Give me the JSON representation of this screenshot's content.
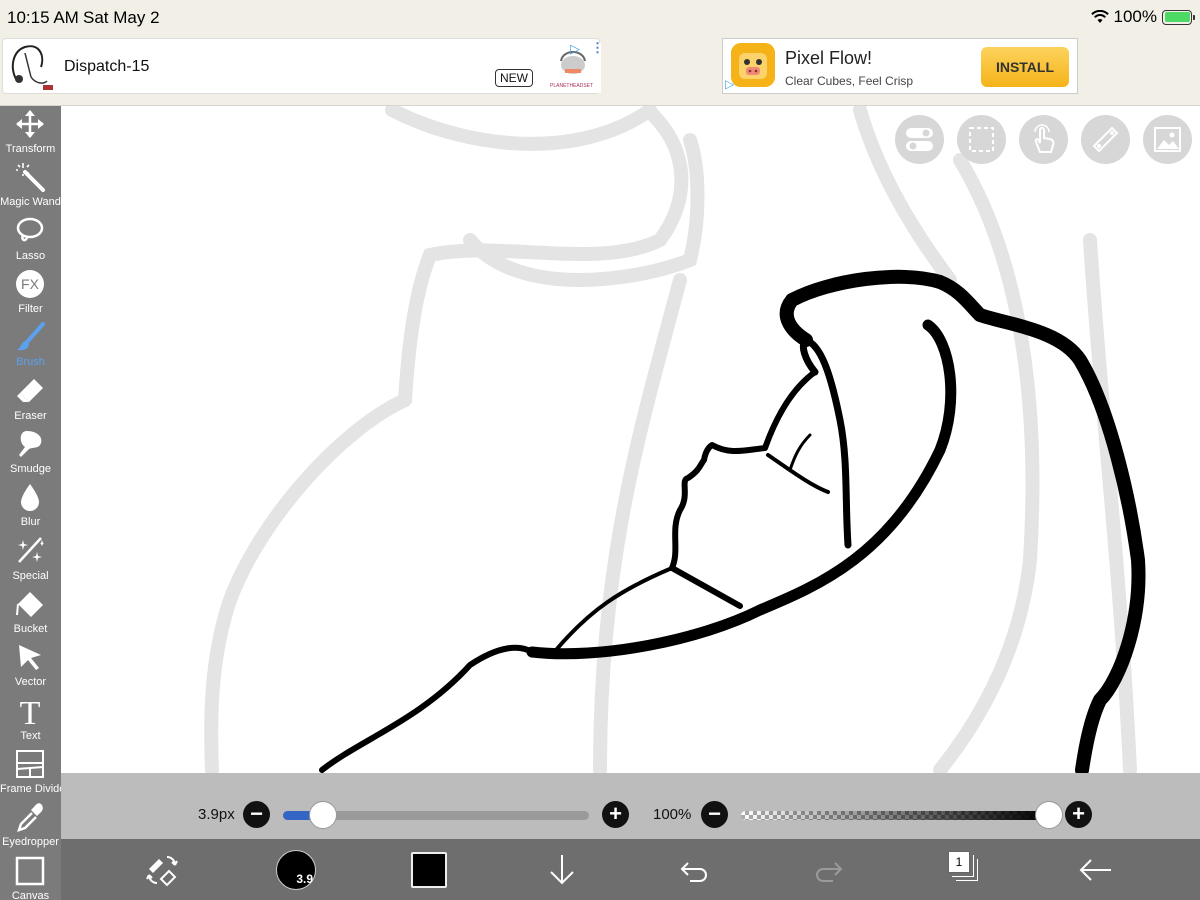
{
  "status_bar": {
    "time": "10:15 AM",
    "date": "Sat May 2",
    "battery": "100%"
  },
  "ads": {
    "left": {
      "title": "Dispatch-15",
      "badge": "NEW",
      "advertiser": "PLANETHEADSET"
    },
    "right": {
      "title": "Pixel Flow!",
      "subtitle": "Clear Cubes, Feel Crisp",
      "install_label": "INSTALL"
    }
  },
  "toolbar": {
    "items": [
      {
        "label": "Transform",
        "icon": "move-arrows-icon"
      },
      {
        "label": "Magic Wand",
        "icon": "magic-wand-icon"
      },
      {
        "label": "Lasso",
        "icon": "lasso-icon"
      },
      {
        "label": "Filter",
        "icon": "fx-icon",
        "glyph": "FX"
      },
      {
        "label": "Brush",
        "icon": "brush-icon",
        "active": true
      },
      {
        "label": "Eraser",
        "icon": "eraser-icon"
      },
      {
        "label": "Smudge",
        "icon": "smudge-icon"
      },
      {
        "label": "Blur",
        "icon": "droplet-icon"
      },
      {
        "label": "Special",
        "icon": "sparkle-icon"
      },
      {
        "label": "Bucket",
        "icon": "bucket-icon"
      },
      {
        "label": "Vector",
        "icon": "cursor-arrow-icon"
      },
      {
        "label": "Text",
        "icon": "text-icon",
        "glyph": "T"
      },
      {
        "label": "Frame Divider",
        "icon": "frame-divider-icon"
      },
      {
        "label": "Eyedropper",
        "icon": "eyedropper-icon"
      },
      {
        "label": "Canvas",
        "icon": "canvas-icon"
      }
    ],
    "accent_color": "#5ba1ee"
  },
  "canvas_buttons": [
    "toggle-icon",
    "selection-icon",
    "hand-touch-icon",
    "ruler-icon",
    "image-icon"
  ],
  "brush_controls": {
    "size_label": "3.9px",
    "size_fraction": 0.13,
    "opacity_label": "100%",
    "opacity_fraction": 1.0,
    "minus": "−",
    "plus": "+"
  },
  "bottom_bar": {
    "brush_preview_label": "3.9",
    "layer_count": "1",
    "color": "#000000"
  }
}
